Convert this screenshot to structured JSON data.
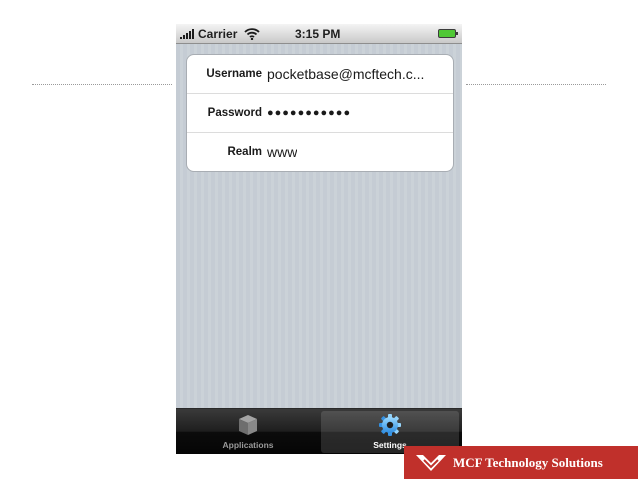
{
  "status_bar": {
    "carrier": "Carrier",
    "time": "3:15 PM",
    "icons": [
      "signal-bars-icon",
      "wifi-icon",
      "battery-icon"
    ],
    "battery_color": "#4fc835"
  },
  "settings_form": {
    "rows": [
      {
        "label": "Username",
        "value": "pocketbase@mcftech.c..."
      },
      {
        "label": "Password",
        "value": "●●●●●●●●●●●"
      },
      {
        "label": "Realm",
        "value": "www"
      }
    ]
  },
  "tab_bar": {
    "tabs": [
      {
        "label": "Applications",
        "icon": "cube-icon",
        "selected": false
      },
      {
        "label": "Settings",
        "icon": "gear-icon",
        "selected": true
      }
    ]
  },
  "branding": {
    "name": "MCF Technology Solutions",
    "color": "#c0302b"
  }
}
